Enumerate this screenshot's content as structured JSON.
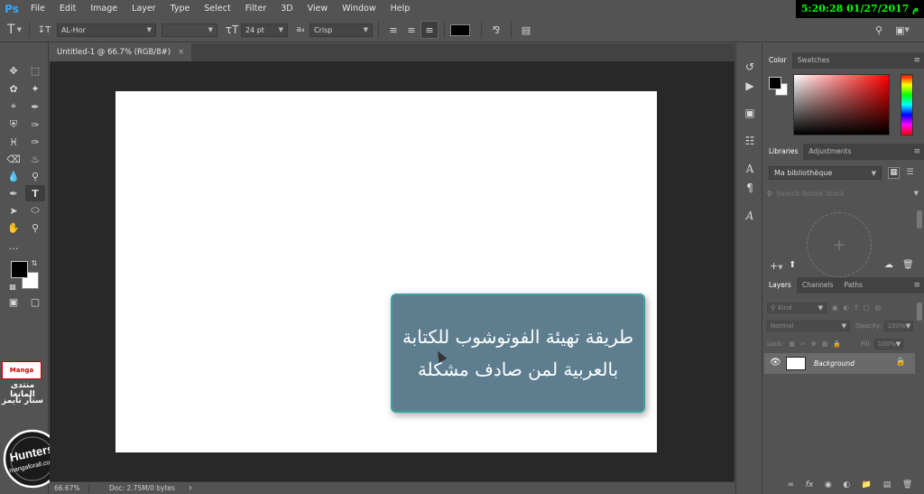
{
  "app": {
    "logo": "Ps",
    "clock": "5:20:28 01/27/2017 م"
  },
  "menu": [
    "File",
    "Edit",
    "Image",
    "Layer",
    "Type",
    "Select",
    "Filter",
    "3D",
    "View",
    "Window",
    "Help"
  ],
  "options": {
    "font_family": "AL-Hor",
    "font_size": "24 pt",
    "aa_icon_label": "a",
    "antialias": "Crisp",
    "text_color": "#000000"
  },
  "document": {
    "tab_title": "Untitled-1 @ 66.7% (RGB/8#)",
    "close_glyph": "×",
    "overlay_line1": "طريقة تهيئة الفوتوشوب للكتابة",
    "overlay_line2": "بالعربية لمن صادف مشكلة"
  },
  "status": {
    "zoom": "66.67%",
    "doc_size": "Doc: 2.75M/0 bytes",
    "arrow": "›"
  },
  "watermark": {
    "manga_logo": "Manga",
    "forum_name": "منتدى المانغا",
    "team_name": "ستار تايمز",
    "hunters_title": "Hunters",
    "hunters_site": "mangaforall.com"
  },
  "color_panel": {
    "tabs": [
      "Color",
      "Swatches"
    ],
    "foreground": "#000000",
    "background": "#ffffff"
  },
  "libraries_panel": {
    "tabs": [
      "Libraries",
      "Adjustments"
    ],
    "library_name": "Ma bibliothèque",
    "search_placeholder": "Search Adobe Stock",
    "add_glyph": "+"
  },
  "layers_panel": {
    "tabs": [
      "Layers",
      "Channels",
      "Paths"
    ],
    "kind_filter": "Kind",
    "blend_mode": "Normal",
    "opacity_label": "Opacity:",
    "opacity_value": "100%",
    "lock_label": "Lock:",
    "fill_label": "Fill:",
    "fill_value": "100%",
    "layers": [
      {
        "name": "Background",
        "visible": true,
        "locked": true
      }
    ]
  }
}
